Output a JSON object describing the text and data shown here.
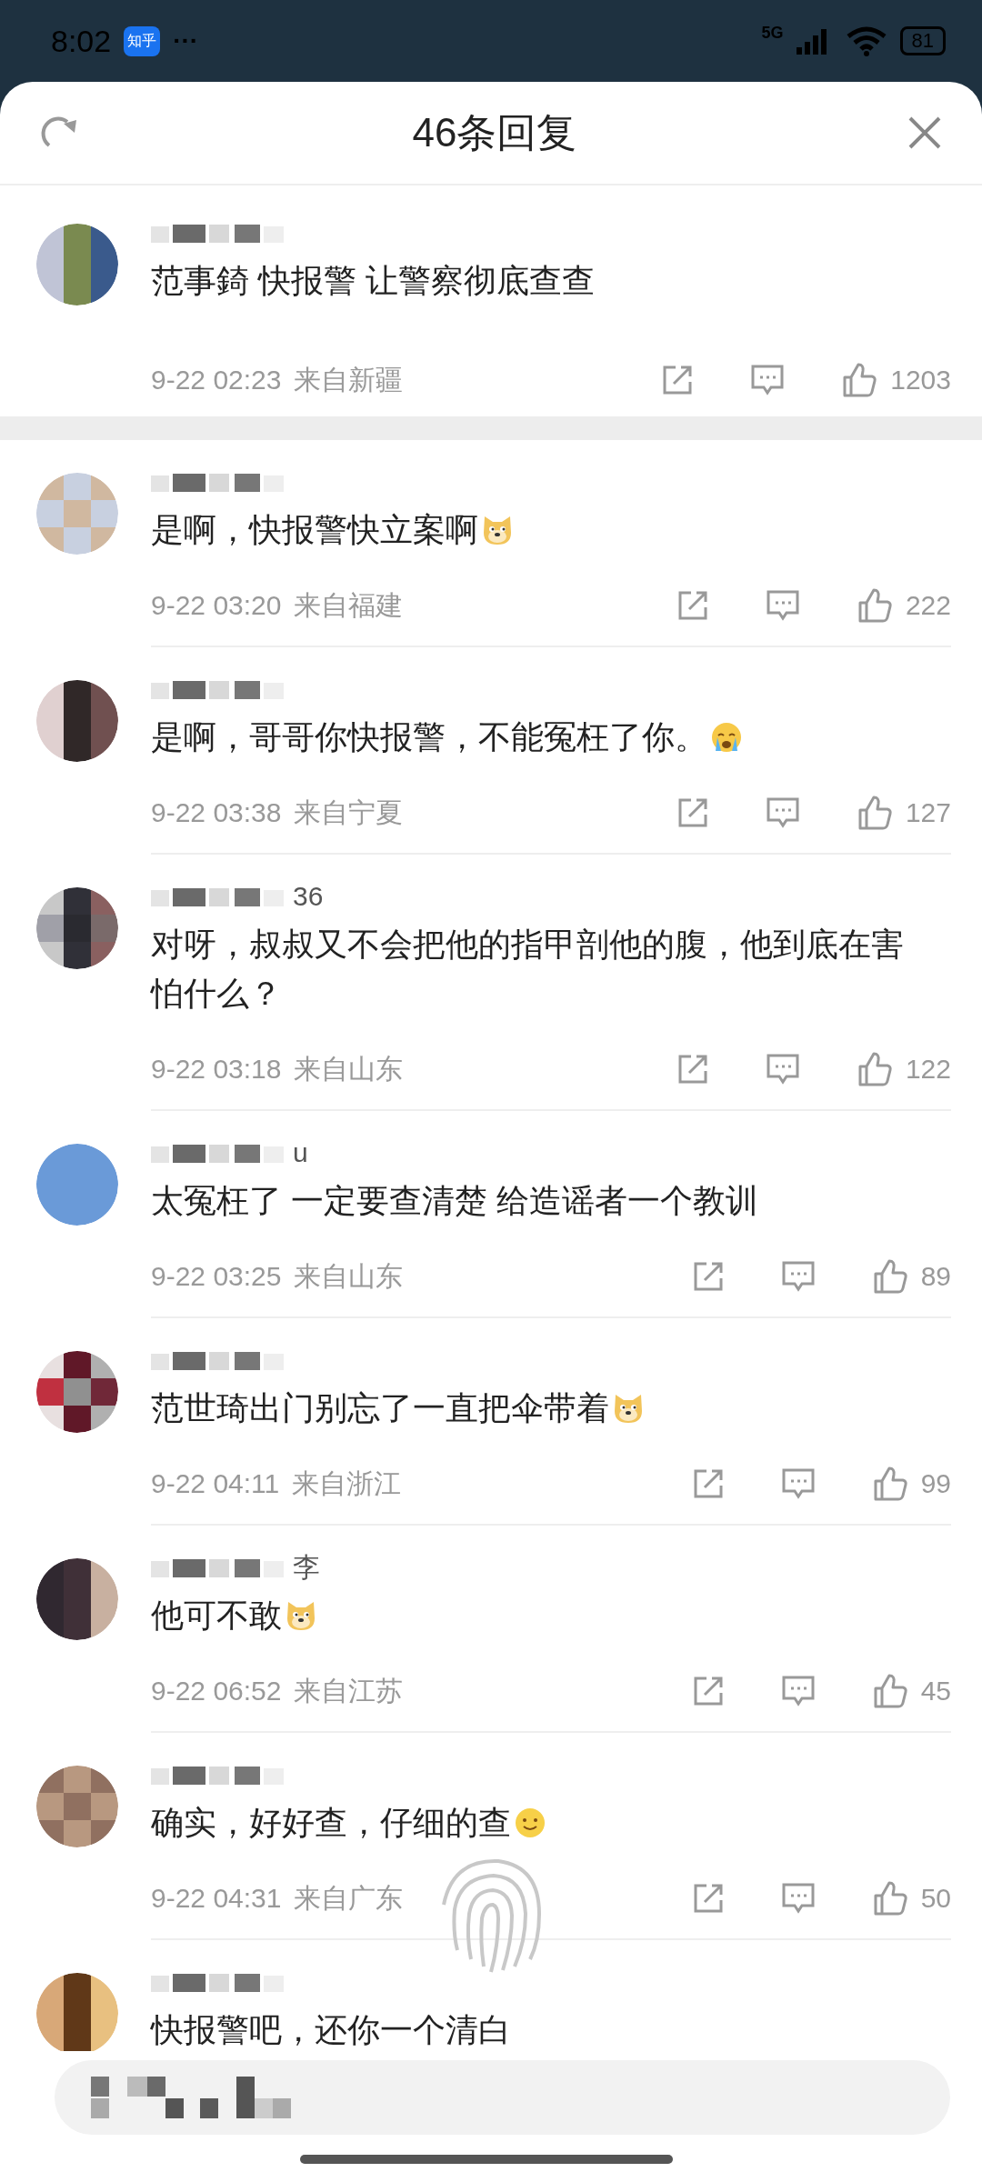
{
  "status_bar": {
    "time": "8:02",
    "app_icon_text": "知乎",
    "more": "···",
    "network": "5G",
    "battery": "81"
  },
  "header": {
    "title": "46条回复"
  },
  "root_comment": {
    "text": "范事錡 快报警 让警察彻底查查",
    "time": "9-22 02:23",
    "location": "来自新疆",
    "likes": "1203"
  },
  "replies": [
    {
      "text": "是啊，快报警快立案啊",
      "emoji": {
        "kind": "dog"
      },
      "time": "9-22 03:20",
      "location": "来自福建",
      "likes": "222"
    },
    {
      "text": "是啊，哥哥你快报警，不能冤枉了你。",
      "emoji": {
        "kind": "crying"
      },
      "time": "9-22 03:38",
      "location": "来自宁夏",
      "likes": "127"
    },
    {
      "name_fragment": "36",
      "text": "对呀，叔叔又不会把他的指甲剖他的腹，他到底在害怕什么？",
      "time": "9-22 03:18",
      "location": "来自山东",
      "likes": "122"
    },
    {
      "name_fragment": "u",
      "text": "太冤枉了  一定要查清楚  给造谣者一个教训",
      "time": "9-22 03:25",
      "location": "来自山东",
      "likes": "89"
    },
    {
      "text": "范世琦出门别忘了一直把伞带着",
      "emoji": {
        "kind": "dog"
      },
      "time": "9-22 04:11",
      "location": "来自浙江",
      "likes": "99"
    },
    {
      "name_fragment": "李",
      "text": "他可不敢",
      "emoji": {
        "kind": "dog"
      },
      "time": "9-22 06:52",
      "location": "来自江苏",
      "likes": "45"
    },
    {
      "text": "确实，好好查，仔细的查",
      "emoji": {
        "kind": "smile"
      },
      "time": "9-22 04:31",
      "location": "来自广东",
      "likes": "50"
    },
    {
      "text": "快报警吧，还你一个清白"
    }
  ]
}
